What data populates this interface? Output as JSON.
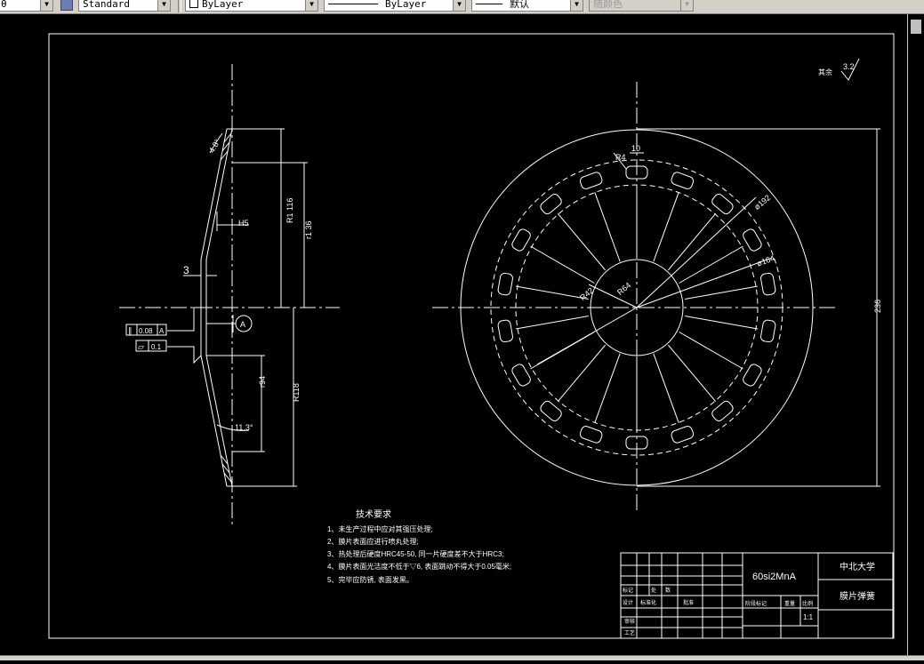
{
  "toolbar": {
    "first_combo": "θ",
    "text_style": "Standard",
    "layer": "ByLayer",
    "linetype": "ByLayer",
    "lineweight": "默认",
    "plotstyle": "随颜色"
  },
  "profile": {
    "angle_top": "4.8°",
    "h5": "H5",
    "r116": "R1 116",
    "r136": "r1 36",
    "dim3": "3",
    "datum": "A",
    "tol1_value": "0.08",
    "tol1_ref": "A",
    "tol2_value": "0.1",
    "r94": "r94",
    "r118": "R118",
    "angle_bottom": "11.3°"
  },
  "plan": {
    "d236": "236",
    "r4": "R4",
    "d10": "10",
    "d192": "ø192",
    "d164": "ø164",
    "r64": "R64",
    "r42": "R42"
  },
  "roughness": {
    "label": "其余",
    "value": "3.2"
  },
  "notes": {
    "title": "技术要求",
    "items": [
      "1、未生产过程中应对其强压处理;",
      "2、膜片表面应进行喷丸处理;",
      "3、热处理后硬度HRC45-50, 同一片硬度差不大于HRC3;",
      "4、膜片表面光洁度不低于▽6, 表面跳动不得大于0.05毫米;",
      "5、完毕应防锈, 表面发黑。"
    ]
  },
  "titleblock": {
    "material": "60si2MnA",
    "school": "中北大学",
    "part_name": "膜片弹簧",
    "row1": [
      "标记",
      "处",
      "数"
    ],
    "row2": [
      "设计",
      "标准化",
      "批准"
    ],
    "stage_label": "阶段标记",
    "weight_label": "重量",
    "scale_label": "比例",
    "scale": "1:1",
    "audit": "审核",
    "process": "工艺"
  }
}
